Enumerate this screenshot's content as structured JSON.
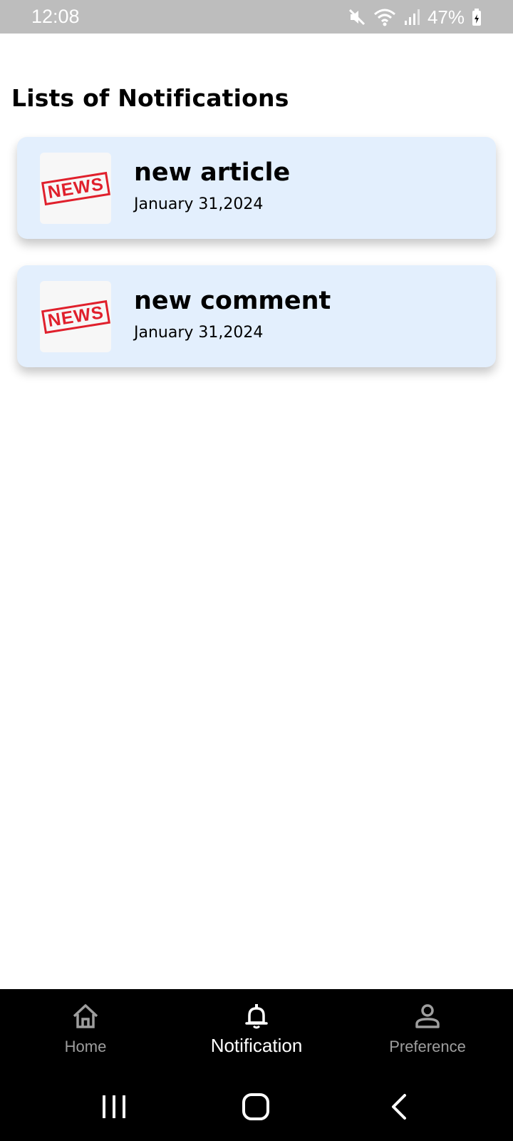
{
  "status_bar": {
    "time": "12:08",
    "battery": "47%",
    "icons": [
      "mute-icon",
      "wifi-icon",
      "signal-icon",
      "battery-icon"
    ]
  },
  "page": {
    "title": "Lists of Notifications"
  },
  "notifications": [
    {
      "thumbnail_text": "NEWS",
      "title": "new article",
      "date": "January 31,2024"
    },
    {
      "thumbnail_text": "NEWS",
      "title": "new comment",
      "date": "January 31,2024"
    }
  ],
  "bottom_nav": {
    "items": [
      {
        "label": "Home",
        "icon": "home-icon",
        "active": false
      },
      {
        "label": "Notification",
        "icon": "bell-icon",
        "active": true
      },
      {
        "label": "Preference",
        "icon": "person-icon",
        "active": false
      }
    ]
  },
  "system_nav": {
    "buttons": [
      "recent-apps-icon",
      "home-circle-icon",
      "back-icon"
    ]
  },
  "colors": {
    "status_bar_bg": "#bdbdbd",
    "card_bg": "#e3effd",
    "stamp_red": "#e0202c",
    "nav_bg": "#000000",
    "nav_inactive": "#9e9e9e",
    "nav_active": "#ffffff"
  }
}
